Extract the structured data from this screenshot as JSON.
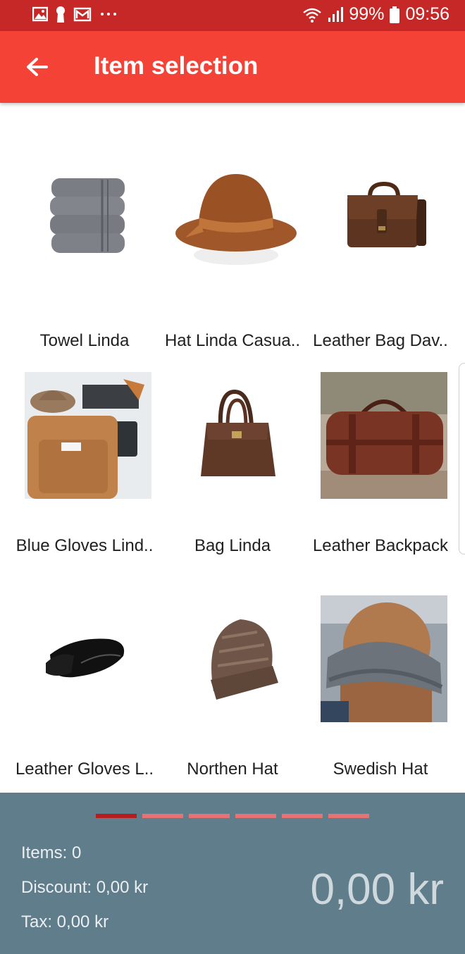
{
  "status_bar": {
    "left_icons": [
      "image-icon",
      "keyhole-icon",
      "mail-icon",
      "more-dots-icon"
    ],
    "battery": "99%",
    "time": "09:56"
  },
  "app_bar": {
    "title": "Item selection",
    "back_icon": "arrow-back-icon"
  },
  "items": [
    {
      "name": "Towel Linda",
      "icon": "towel-stack-icon"
    },
    {
      "name": "Hat Linda Casua..",
      "icon": "brown-hat-icon"
    },
    {
      "name": "Leather Bag Dav..",
      "icon": "leather-satchel-icon"
    },
    {
      "name": "Blue Gloves Lind..",
      "icon": "backpack-flatlay-photo"
    },
    {
      "name": "Bag Linda",
      "icon": "handbag-icon"
    },
    {
      "name": "Leather Backpack",
      "icon": "duffel-bag-photo"
    },
    {
      "name": "Leather Gloves L..",
      "icon": "black-gloves-icon"
    },
    {
      "name": "Northen Hat",
      "icon": "beanie-icon"
    },
    {
      "name": "Swedish Hat",
      "icon": "scarf-person-photo"
    }
  ],
  "pager": {
    "pages": 6,
    "active": 0
  },
  "summary": {
    "items": "Items: 0",
    "discount": "Discount: 0,00 kr",
    "tax": "Tax: 0,00 kr",
    "total": "0,00 kr"
  },
  "colors": {
    "status_bar": "#c62828",
    "app_bar": "#f44336",
    "footer": "#607d8b",
    "pager_active": "#b71c1c",
    "pager_inactive": "#e57373"
  }
}
